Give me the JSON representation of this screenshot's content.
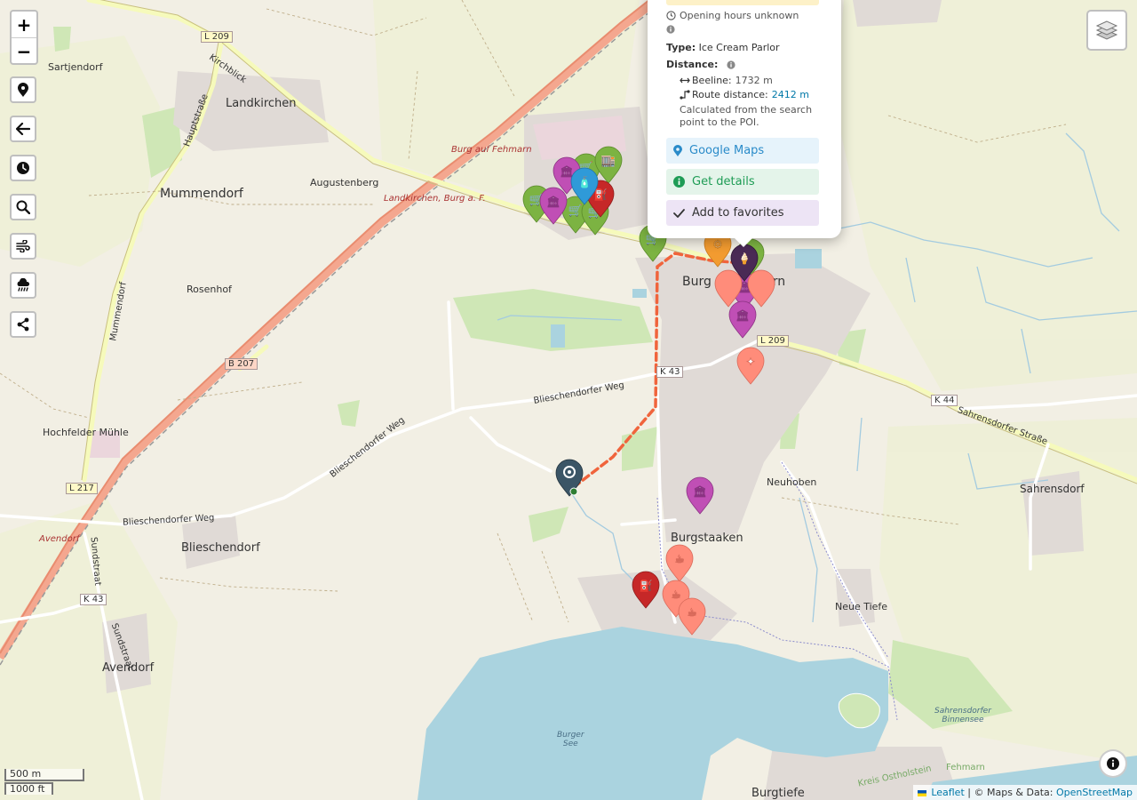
{
  "map": {
    "places": {
      "sartjendorf": "Sartjendorf",
      "landkirchen": "Landkirchen",
      "mummendorf": "Mummendorf",
      "augustenberg": "Augustenberg",
      "rosenhof": "Rosenhof",
      "hochfelder_muehle": "Hochfelder Mühle",
      "blieschendorf": "Blieschendorf",
      "avendorf": "Avendorf",
      "burg": "Burg auf Fehmarn",
      "burg_short": "Burg a. Fehmarn",
      "landkirchen_burg": "Landkirchen, Burg a. F.",
      "burgstaaken": "Burgstaaken",
      "neuhoben": "Neuhoben",
      "sahrensdorf": "Sahrensdorf",
      "neue_tiefe": "Neue Tiefe",
      "burgtiefe": "Burgtiefe",
      "burger_see": "Burger\nSee",
      "sahrensdorfer_binnensee": "Sahrensdorfer\nBinnensee",
      "avendorf_red": "Avendorf",
      "kreis": "Kreis Ostholstein",
      "fehmarn": "Fehmarn"
    },
    "streets": {
      "hauptstrasse": "Hauptstraße",
      "kirchblick": "Kirchblick",
      "mummendorf_road": "Mummendorf",
      "blieschendorfer_weg_1": "Blieschendorfer Weg",
      "blieschendorfer_weg_2": "Blieschendorfer Weg",
      "blieschendorfer_weg_3": "Blieschendorfer Weg",
      "sundstraat_1": "Sundstraat",
      "sundstraat_2": "Sundstraat",
      "sahrensdorfer_strasse": "Sahrensdorfer Straße"
    },
    "road_shields": {
      "l209_a": "L 209",
      "l209_b": "L 209",
      "b207": "B 207",
      "k43_a": "K 43",
      "k43_b": "K 43",
      "k44": "K 44",
      "l217": "L 217"
    }
  },
  "controls": {
    "zoom_in": "+",
    "zoom_out": "−"
  },
  "popup": {
    "hours": "Opening hours unknown",
    "type_label": "Type:",
    "type_value": "Ice Cream Parlor",
    "distance_label": "Distance:",
    "beeline_label": "Beeline:",
    "beeline_value": "1732 m",
    "route_label": "Route distance:",
    "route_value": "2412 m",
    "calc_note": "Calculated from the search point to the POI.",
    "google_maps": "Google Maps",
    "get_details": "Get details",
    "add_favorites": "Add to favorites"
  },
  "scale": {
    "metric": "500 m",
    "imperial": "1000 ft"
  },
  "attribution": {
    "leaflet": "Leaflet",
    "sep": "|",
    "maps_data": "© Maps & Data:",
    "osm": "OpenStreetMap"
  },
  "colors": {
    "route": "#f0643c",
    "food": "#ff8c7a",
    "shop": "#7cb342",
    "museum": "#c04fb5",
    "fuel": "#c62828",
    "search_point": "#3b5566"
  }
}
